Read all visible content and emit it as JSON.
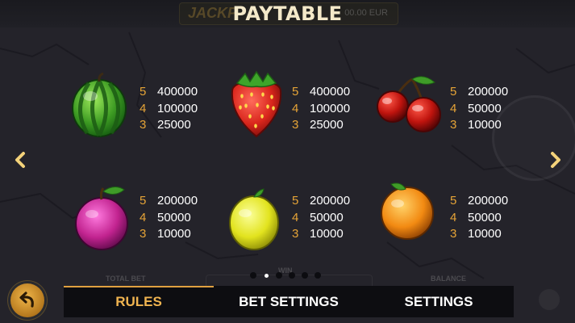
{
  "header": {
    "title": "PAYTABLE",
    "jackpot_ghost": "JACKP",
    "jackpot_amount_ghost": "00.00 EUR"
  },
  "symbols": [
    {
      "name": "watermelon",
      "pays": [
        {
          "count": "5",
          "win": "400000"
        },
        {
          "count": "4",
          "win": "100000"
        },
        {
          "count": "3",
          "win": "25000"
        }
      ]
    },
    {
      "name": "strawberry",
      "pays": [
        {
          "count": "5",
          "win": "400000"
        },
        {
          "count": "4",
          "win": "100000"
        },
        {
          "count": "3",
          "win": "25000"
        }
      ]
    },
    {
      "name": "cherries",
      "pays": [
        {
          "count": "5",
          "win": "200000"
        },
        {
          "count": "4",
          "win": "50000"
        },
        {
          "count": "3",
          "win": "10000"
        }
      ]
    },
    {
      "name": "plum",
      "pays": [
        {
          "count": "5",
          "win": "200000"
        },
        {
          "count": "4",
          "win": "50000"
        },
        {
          "count": "3",
          "win": "10000"
        }
      ]
    },
    {
      "name": "lemon",
      "pays": [
        {
          "count": "5",
          "win": "200000"
        },
        {
          "count": "4",
          "win": "50000"
        },
        {
          "count": "3",
          "win": "10000"
        }
      ]
    },
    {
      "name": "orange",
      "pays": [
        {
          "count": "5",
          "win": "200000"
        },
        {
          "count": "4",
          "win": "50000"
        },
        {
          "count": "3",
          "win": "10000"
        }
      ]
    }
  ],
  "pagination": {
    "total": 6,
    "current": 2
  },
  "ghost_labels": {
    "total_bet": "TOTAL BET",
    "win": "WIN",
    "balance": "BALANCE"
  },
  "tabs": [
    {
      "label": "RULES",
      "active": true
    },
    {
      "label": "BET SETTINGS",
      "active": false
    },
    {
      "label": "SETTINGS",
      "active": false
    }
  ],
  "colors": {
    "accent": "#e6a437",
    "background": "#24232a",
    "tab_bar": "#0d0d11"
  },
  "icons": {
    "back": "back-arrow-icon",
    "prev": "chevron-left-icon",
    "next": "chevron-right-icon"
  }
}
